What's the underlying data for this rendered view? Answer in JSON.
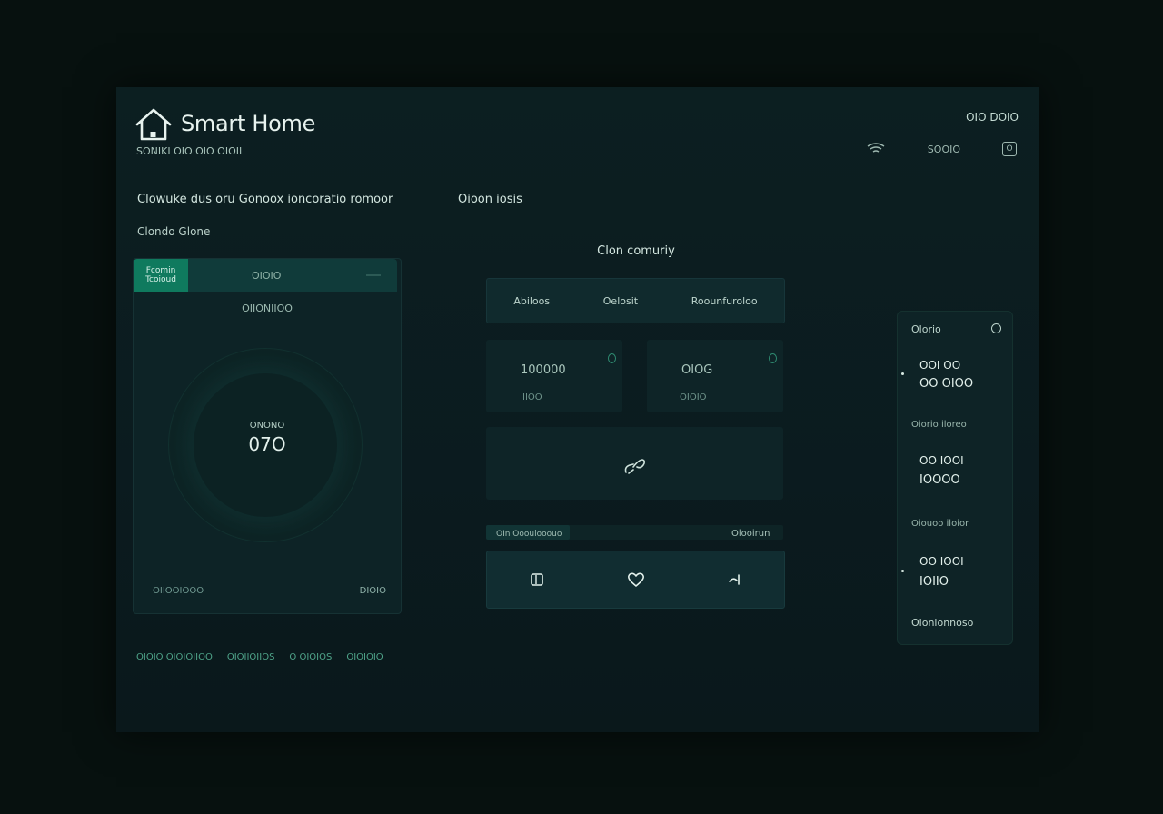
{
  "app": {
    "title": "Smart Home",
    "subtitle": "SONIKI   OIO  OIO OIOII"
  },
  "header": {
    "top_right_text": "OIO  DOIO",
    "right_item_label": "SOOIO",
    "right_icon_glyph": "O"
  },
  "sections": {
    "left_title": "Clowuke dus oru Gonoox ioncoratio romoor",
    "left_subtitle": "Clondo Glone",
    "center_title": "Oioon iosis"
  },
  "left_panel": {
    "tab_active": "Fcomin Tcoioud",
    "tab_second": "OIOIO",
    "label": "OIIONIIOO",
    "dial_label": "ONONO",
    "dial_value": "07O",
    "footer_left": "OIIOOIOOO",
    "footer_right": "DIOIO"
  },
  "bottom_links": [
    "OIOIO OIOIOIIOO",
    "OIOIIOIIOS",
    "O OIOIOS",
    "OIOIOIO"
  ],
  "center": {
    "card_title": "Clon comuriy",
    "tabs": [
      "Abiloos",
      "Oelosit",
      "Roounfuroloo"
    ],
    "metrics": [
      {
        "value": "100000",
        "sub": "IIOO"
      },
      {
        "value": "OIOG",
        "sub": "OIOIO"
      }
    ],
    "progress": {
      "fraction": 0.28,
      "label_left": "OIn Ooouiooouo",
      "label_right": "Olooirun"
    }
  },
  "right_panel": {
    "title": "Olorio",
    "groups": [
      {
        "label": "",
        "line1": "OOI OO",
        "line2": "OO OIOO"
      },
      {
        "label": "Oiorio iloreo",
        "line1": "OO IOOI",
        "line2": "IOOOO"
      },
      {
        "label": "Oiouoo iloior",
        "line1": "OO IOOI",
        "line2": "IOIIO"
      }
    ],
    "footer": "Oionionnoso"
  },
  "colors": {
    "accent": "#0f7a5e",
    "accent_text": "#4fa58a",
    "background": "#07110f",
    "panel": "#0d2326"
  },
  "icons": {
    "logo": "house-icon",
    "header_right_1": "wifi-icon",
    "header_right_2": "settings-icon",
    "center_visual": "link-icon",
    "controls": [
      "square-icon",
      "heart-icon",
      "arrow-icon"
    ]
  }
}
